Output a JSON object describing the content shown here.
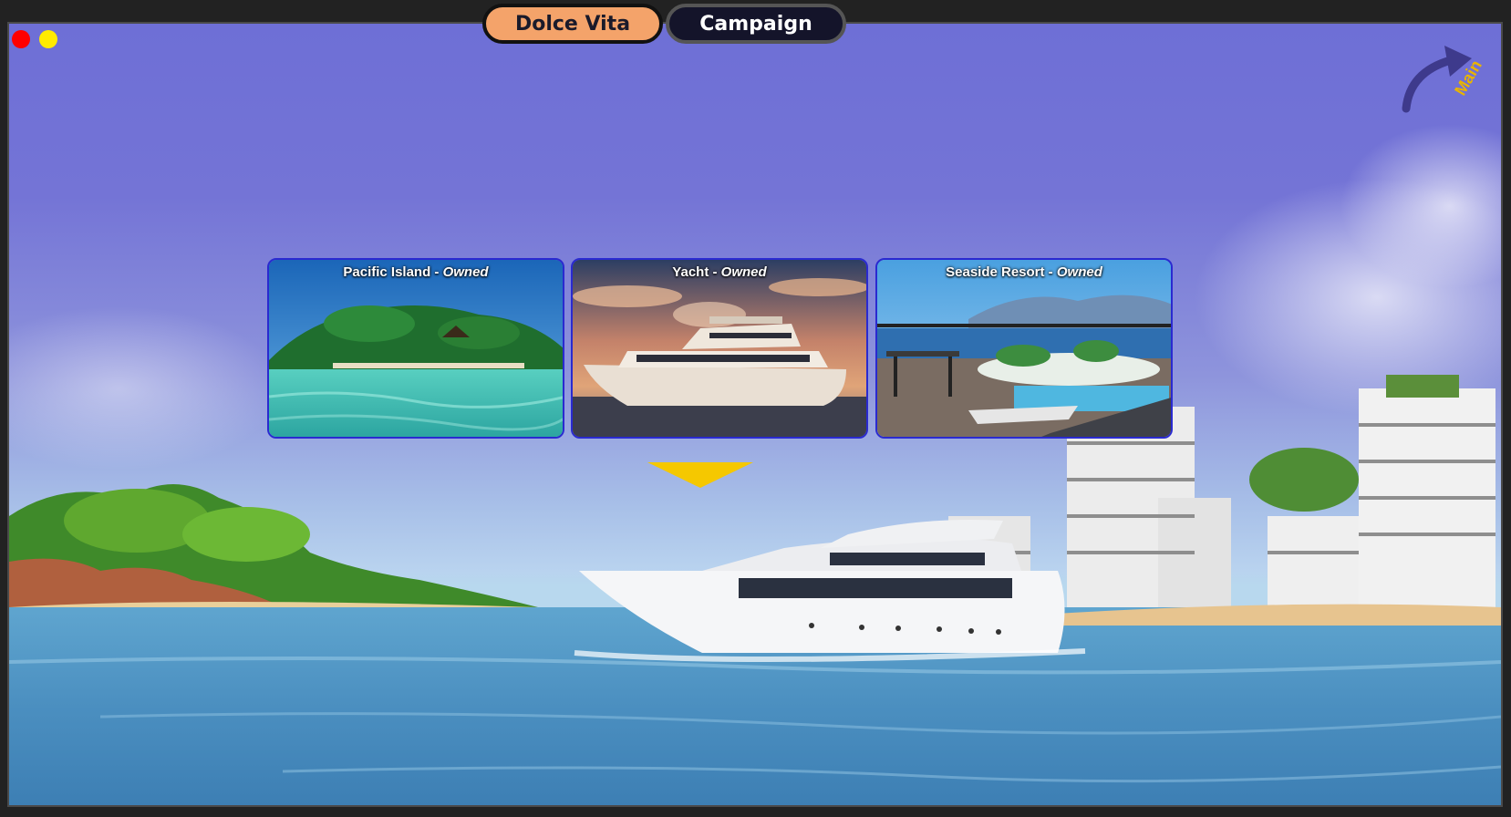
{
  "tabs": [
    {
      "label": "Dolce Vita",
      "active": true
    },
    {
      "label": "Campaign",
      "active": false
    }
  ],
  "window_controls": {
    "close_color": "#ff0000",
    "minimize_color": "#ffeb00"
  },
  "nav": {
    "main_label": "Main"
  },
  "properties": [
    {
      "name": "Pacific Island",
      "separator": " - ",
      "status": "Owned"
    },
    {
      "name": "Yacht",
      "separator": " - ",
      "status": "Owned"
    },
    {
      "name": "Seaside Resort",
      "separator": " - ",
      "status": "Owned"
    }
  ],
  "selected_property": "Yacht",
  "colors": {
    "active_tab": "#f4a36a",
    "inactive_tab": "#14142a",
    "card_border": "#2a2ad0",
    "pointer": "#f5c800",
    "main_label": "#e8b400"
  }
}
